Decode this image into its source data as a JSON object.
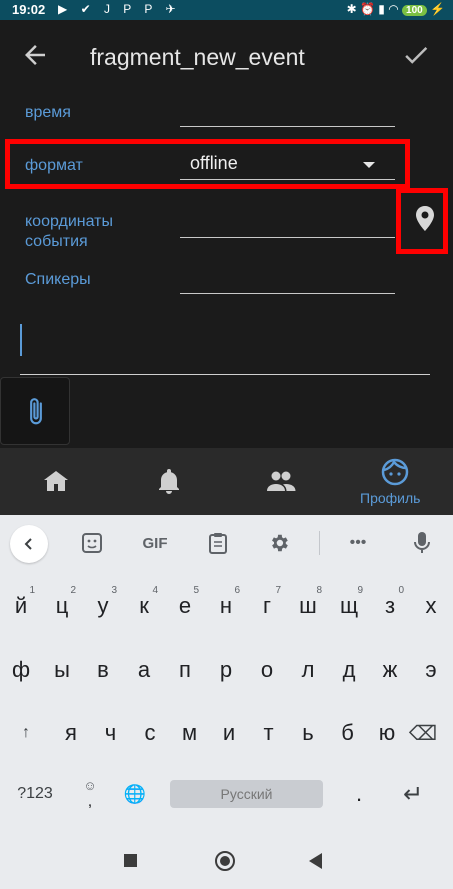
{
  "status_bar": {
    "time": "19:02",
    "left_icons": "▶ ✔ J P P ✈",
    "right_icons": "✱ ⏰ ▮ ◠",
    "battery": "100"
  },
  "app_bar": {
    "title": "fragment_new_event",
    "back_icon": "arrow-back-icon",
    "confirm_icon": "check-icon"
  },
  "form": {
    "time_label": "время",
    "time_value": "",
    "format_label": "формат",
    "format_value": "offline",
    "coords_label_line1": "координаты",
    "coords_label_line2": "события",
    "coords_value": "",
    "speakers_label": "Спикеры",
    "speakers_value": "",
    "text_value": "",
    "highlight_color": "#ff0000",
    "accent_color": "#5b9bd8"
  },
  "bottom_nav": {
    "items": [
      {
        "icon": "home-icon",
        "label": ""
      },
      {
        "icon": "bell-icon",
        "label": ""
      },
      {
        "icon": "people-icon",
        "label": ""
      },
      {
        "icon": "profile-face-icon",
        "label": "Профиль"
      }
    ]
  },
  "keyboard": {
    "toolbar": {
      "back_icon": "chevron-left-icon",
      "sticker_icon": "sticker-icon",
      "gif_label": "GIF",
      "clipboard_icon": "clipboard-icon",
      "settings_icon": "gear-icon",
      "more_label": "•••",
      "mic_icon": "mic-icon"
    },
    "row1": [
      {
        "k": "й",
        "h": "1"
      },
      {
        "k": "ц",
        "h": "2"
      },
      {
        "k": "у",
        "h": "3"
      },
      {
        "k": "к",
        "h": "4"
      },
      {
        "k": "е",
        "h": "5"
      },
      {
        "k": "н",
        "h": "6"
      },
      {
        "k": "г",
        "h": "7"
      },
      {
        "k": "ш",
        "h": "8"
      },
      {
        "k": "щ",
        "h": "9"
      },
      {
        "k": "з",
        "h": "0"
      },
      {
        "k": "х",
        "h": ""
      }
    ],
    "row2": [
      "ф",
      "ы",
      "в",
      "а",
      "п",
      "р",
      "о",
      "л",
      "д",
      "ж",
      "э"
    ],
    "row3": [
      "я",
      "ч",
      "с",
      "м",
      "и",
      "т",
      "ь",
      "б",
      "ю"
    ],
    "shift_label": "↑",
    "backspace_label": "⌫",
    "numbers_label": "?123",
    "emoji_label": "☺",
    "comma_label": ",",
    "globe_label": "🌐",
    "space_label": "Русский",
    "period_label": ".",
    "enter_label": "↵"
  },
  "system_nav": {
    "recents_icon": "square-icon",
    "home_icon": "circle-home-icon",
    "back_icon": "triangle-back-icon"
  }
}
